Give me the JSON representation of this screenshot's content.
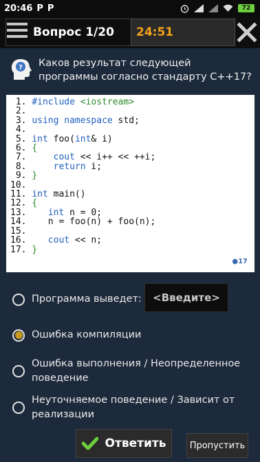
{
  "status": {
    "time": "20:46",
    "carrier_icons": [
      "P",
      "P"
    ],
    "battery": "72"
  },
  "header": {
    "title": "Вопрос 1/20",
    "timer": "24:51"
  },
  "question": {
    "text": "Каков результат следующей программы согласно стандарту С++17?"
  },
  "code": {
    "lines": [
      {
        "n": "1.",
        "text": "#include <iostream>"
      },
      {
        "n": "2.",
        "text": ""
      },
      {
        "n": "3.",
        "text": "using namespace std;"
      },
      {
        "n": "4.",
        "text": ""
      },
      {
        "n": "5.",
        "text": "int foo(int& i)"
      },
      {
        "n": "6.",
        "text": "{"
      },
      {
        "n": "7.",
        "text": "    cout << i++ << ++i;"
      },
      {
        "n": "8.",
        "text": "    return i;"
      },
      {
        "n": "9.",
        "text": "}"
      },
      {
        "n": "10.",
        "text": ""
      },
      {
        "n": "11.",
        "text": "int main()"
      },
      {
        "n": "12.",
        "text": "{"
      },
      {
        "n": "13.",
        "text": "   int n = 0;"
      },
      {
        "n": "14.",
        "text": "   n = foo(n) + foo(n);"
      },
      {
        "n": "15.",
        "text": ""
      },
      {
        "n": "16.",
        "text": "   cout << n;"
      },
      {
        "n": "17.",
        "text": "}"
      }
    ],
    "badge": "17"
  },
  "options": [
    {
      "label": "Программа выведет:",
      "selected": false
    },
    {
      "label": "Ошибка компиляции",
      "selected": true
    },
    {
      "label": "Ошибка выполнения / Неопределенное поведение",
      "selected": false
    },
    {
      "label": "Неуточняемое поведение / Зависит от реализации",
      "selected": false
    }
  ],
  "input": {
    "placeholder": "<Введите>"
  },
  "buttons": {
    "answer": "Ответить",
    "skip": "Пропустить"
  },
  "colors": {
    "accent": "#f3a21a",
    "selected_radio": "#c79a1e",
    "check": "#6ccf3d",
    "background": "#1d2a3c"
  }
}
